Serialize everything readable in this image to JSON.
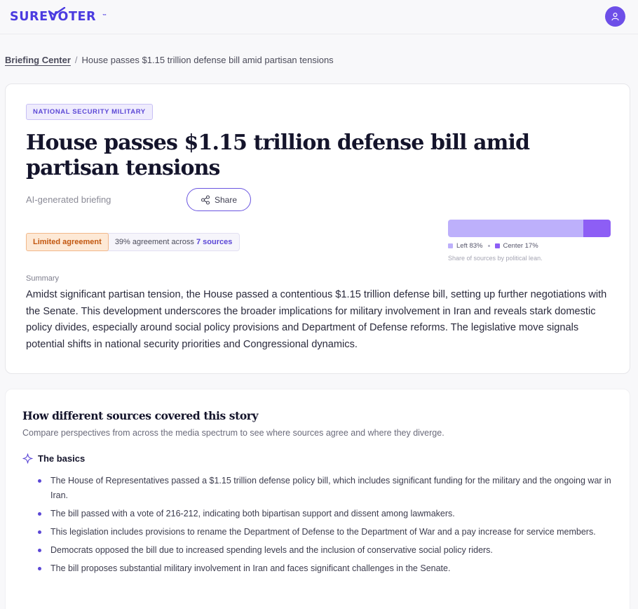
{
  "header": {
    "logo_text": "SUREVOTER",
    "logo_tm": "™",
    "user_icon": "user-icon"
  },
  "breadcrumb": {
    "root": "Briefing Center",
    "separator": "/",
    "current": "House passes $1.15 trillion defense bill amid partisan tensions"
  },
  "article": {
    "tag": "NATIONAL SECURITY MILITARY",
    "headline": "House passes $1.15 trillion defense bill amid partisan tensions",
    "ai_label": "AI-generated briefing",
    "share_label": "Share",
    "agreement": {
      "badge": "Limited agreement",
      "text_prefix": "39% agreement across",
      "sources": "7 sources",
      "percent": 39
    },
    "lean": {
      "left_label": "Left 83%",
      "center_label": "Center 17%",
      "left_fraction": 0.83,
      "center_fraction": 0.17,
      "caption": "Share of sources by political lean.",
      "colors": {
        "left": "#bdb0fb",
        "center": "#8d5ef5"
      }
    },
    "summary_label": "Summary",
    "summary": "Amidst significant partisan tension, the House passed a contentious $1.15 trillion defense bill, setting up further negotiations with the Senate. This development underscores the broader implications for military involvement in Iran and reveals stark domestic policy divides, especially around social policy provisions and Department of Defense reforms. The legislative move signals potential shifts in national security priorities and Congressional dynamics."
  },
  "coverage": {
    "title": "How different sources covered this story",
    "subtitle": "Compare perspectives from across the media spectrum to see where sources agree and where they diverge.",
    "basics_title": "The basics",
    "basics": [
      "The House of Representatives passed a $1.15 trillion defense policy bill, which includes significant funding for the military and the ongoing war in Iran.",
      "The bill passed with a vote of 216-212, indicating both bipartisan support and dissent among lawmakers.",
      "This legislation includes provisions to rename the Department of Defense to the Department of War and a pay increase for service members.",
      "Democrats opposed the bill due to increased spending levels and the inclusion of conservative social policy riders.",
      "The bill proposes substantial military involvement in Iran and faces significant challenges in the Senate."
    ]
  },
  "colors": {
    "brand": "#4b3be0",
    "accent": "#6d4fe8",
    "warning_badge": "#c2560e"
  }
}
